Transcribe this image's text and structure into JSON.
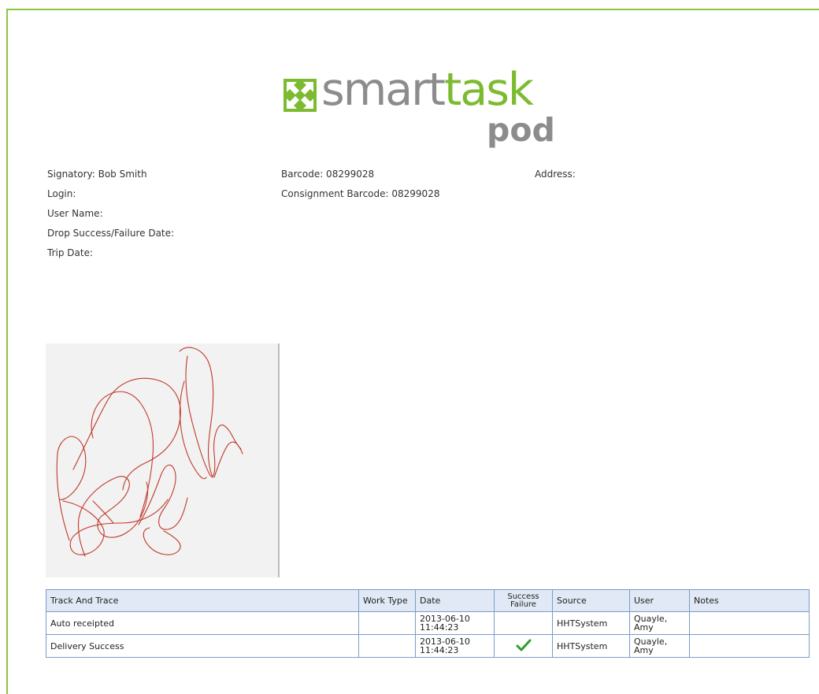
{
  "header": {
    "logo": {
      "word_primary": "smart",
      "word_accent": "task",
      "sub_word": "pod",
      "mark_icon": "arrows-cross-icon",
      "colors": {
        "green": "#7cbb2f",
        "gray": "#8c8c8c"
      }
    }
  },
  "details": {
    "signatory": "Signatory: Bob Smith",
    "login": "Login:",
    "user_name": "User Name:",
    "drop_date": "Drop Success/Failure Date:",
    "trip_date": "Trip Date:",
    "barcode": "Barcode: 08299028",
    "consignment_barcode": "Consignment Barcode: 08299028",
    "address": "Address:"
  },
  "signature": {
    "ink_color": "#c0392b",
    "background": "#f2f2f2"
  },
  "table": {
    "headers": [
      "Track And Trace",
      "Work Type",
      "Date",
      "Success Failure",
      "Source",
      "User",
      "Notes"
    ],
    "header_success_line1": "Success",
    "header_success_line2": "Failure",
    "rows": [
      {
        "event": "Auto receipted",
        "work_type": "",
        "date_line1": "2013-06-10",
        "date_line2": "11:44:23",
        "success": "",
        "source": "HHTSystem",
        "user_line1": "Quayle,",
        "user_line2": "Amy",
        "notes": ""
      },
      {
        "event": "Delivery Success",
        "work_type": "",
        "date_line1": "2013-06-10",
        "date_line2": "11:44:23",
        "success": "check-icon",
        "source": "HHTSystem",
        "user_line1": "Quayle,",
        "user_line2": "Amy",
        "notes": ""
      }
    ],
    "accent_color": "#7a9cc6",
    "check_color": "#2e9e2e"
  }
}
